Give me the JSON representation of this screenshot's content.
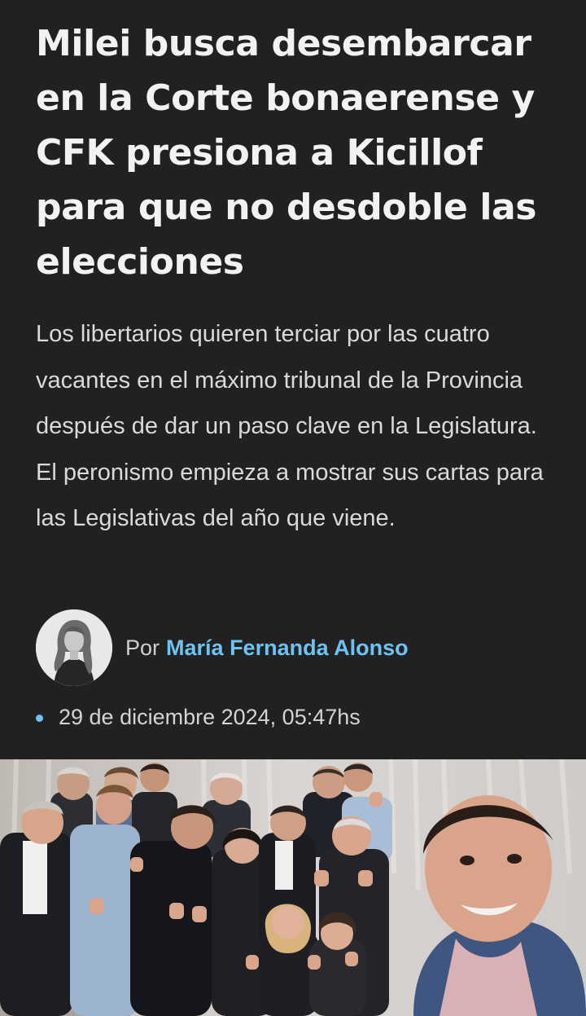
{
  "article": {
    "headline": "Milei busca desembarcar en la Corte bonaerense y CFK presiona a Kicillof para que no desdoble las elecciones",
    "lede": "Los libertarios quieren terciar por las cuatro vacantes en el máximo tribunal de la Provincia después de dar un paso clave en la Legislatura. El peronismo empieza a mostrar sus cartas para las Legislativas del año que viene.",
    "byline": {
      "prefix": "Por",
      "author": "María Fernanda Alonso"
    },
    "date": "29 de diciembre 2024, 05:47hs"
  },
  "colors": {
    "background": "#212121",
    "headline": "#f2f2f2",
    "body_text": "#dadada",
    "accent_link": "#6ec3f2"
  },
  "icons": {
    "date_marker": "bullet-dot-icon"
  }
}
